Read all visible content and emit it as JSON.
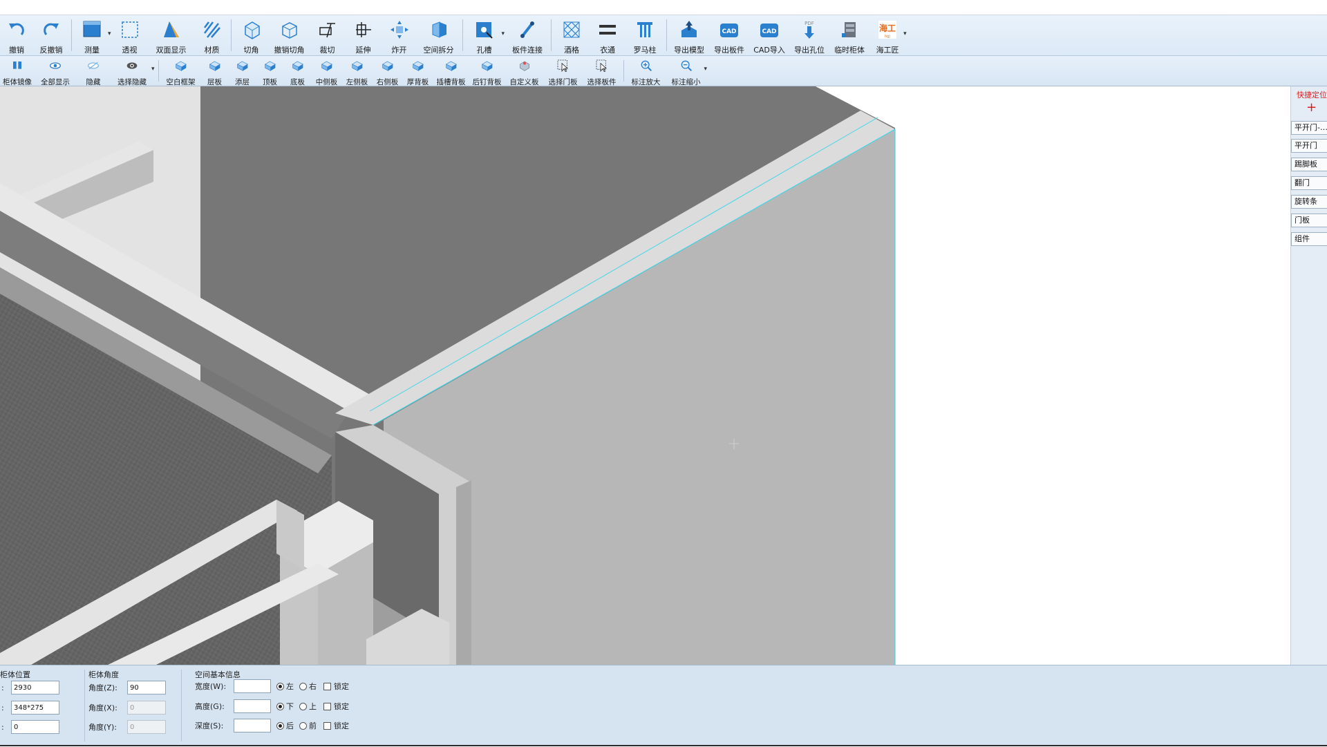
{
  "colors": {
    "accent": "#2a7fcf",
    "selection_edge": "#43d6e8",
    "quick_locate": "#d81e1e",
    "panel_bg": "#d6e4f2"
  },
  "toolbar1": [
    {
      "id": "undo",
      "label": "撤销",
      "icon": "undo-icon"
    },
    {
      "id": "redo",
      "label": "反撤销",
      "icon": "redo-icon"
    },
    {
      "id": "measure",
      "label": "测量",
      "icon": "measure-icon",
      "dropdown": true
    },
    {
      "id": "perspective",
      "label": "透视",
      "icon": "perspective-icon"
    },
    {
      "id": "double-side",
      "label": "双面显示",
      "icon": "double-side-icon"
    },
    {
      "id": "material",
      "label": "材质",
      "icon": "material-icon"
    },
    {
      "id": "cut-corner",
      "label": "切角",
      "icon": "cut-corner-icon"
    },
    {
      "id": "undo-cut-corner",
      "label": "撤销切角",
      "icon": "undo-cut-corner-icon"
    },
    {
      "id": "trim",
      "label": "裁切",
      "icon": "trim-icon"
    },
    {
      "id": "extend",
      "label": "延伸",
      "icon": "extend-icon"
    },
    {
      "id": "explode",
      "label": "炸开",
      "icon": "explode-icon"
    },
    {
      "id": "space-split",
      "label": "空间拆分",
      "icon": "space-split-icon"
    },
    {
      "id": "hole-slot",
      "label": "孔槽",
      "icon": "hole-slot-icon",
      "dropdown": true
    },
    {
      "id": "board-connect",
      "label": "板件连接",
      "icon": "board-connect-icon"
    },
    {
      "id": "grid",
      "label": "酒格",
      "icon": "grid-icon"
    },
    {
      "id": "hanger",
      "label": "衣通",
      "icon": "hanger-icon"
    },
    {
      "id": "roman-column",
      "label": "罗马柱",
      "icon": "roman-column-icon"
    },
    {
      "id": "export-model",
      "label": "导出模型",
      "icon": "export-model-icon"
    },
    {
      "id": "export-board",
      "label": "导出板件",
      "icon": "cad-export-board-icon",
      "badge": "CAD"
    },
    {
      "id": "cad-import",
      "label": "CAD导入",
      "icon": "cad-import-icon",
      "badge": "CAD"
    },
    {
      "id": "export-holes",
      "label": "导出孔位",
      "icon": "pdf-export-icon",
      "badge": "PDF"
    },
    {
      "id": "temp-cabinet",
      "label": "临时柜体",
      "icon": "temp-cabinet-icon"
    },
    {
      "id": "haigongjiang",
      "label": "海工匠",
      "icon": "haigongjiang-logo-icon",
      "badge": "海工匠",
      "dropdown": true
    }
  ],
  "toolbar2": [
    {
      "id": "cabinet-mirror",
      "label": "柜体镜像",
      "icon": "cabinet-mirror-icon"
    },
    {
      "id": "show-all",
      "label": "全部显示",
      "icon": "eye-icon"
    },
    {
      "id": "hide",
      "label": "隐藏",
      "icon": "eye-hide-icon"
    },
    {
      "id": "select-hide",
      "label": "选择隐藏",
      "icon": "eye-select-icon",
      "dropdown": true
    },
    {
      "id": "blank-frame",
      "label": "空白框架",
      "icon": "blank-frame-icon"
    },
    {
      "id": "shelf",
      "label": "层板",
      "icon": "shelf-icon"
    },
    {
      "id": "add-layer",
      "label": "添层",
      "icon": "add-layer-icon"
    },
    {
      "id": "top-board",
      "label": "顶板",
      "icon": "top-board-icon"
    },
    {
      "id": "bottom-board",
      "label": "底板",
      "icon": "bottom-board-icon"
    },
    {
      "id": "middle-side",
      "label": "中侧板",
      "icon": "middle-side-icon"
    },
    {
      "id": "left-side",
      "label": "左侧板",
      "icon": "left-side-icon"
    },
    {
      "id": "right-side",
      "label": "右侧板",
      "icon": "right-side-icon"
    },
    {
      "id": "thick-back",
      "label": "厚背板",
      "icon": "thick-back-icon"
    },
    {
      "id": "slot-back",
      "label": "插槽背板",
      "icon": "slot-back-icon"
    },
    {
      "id": "nail-back",
      "label": "后钉背板",
      "icon": "nail-back-icon"
    },
    {
      "id": "custom-board",
      "label": "自定义板",
      "icon": "custom-board-icon"
    },
    {
      "id": "select-door",
      "label": "选择门板",
      "icon": "select-door-icon"
    },
    {
      "id": "select-part",
      "label": "选择板件",
      "icon": "select-part-icon"
    },
    {
      "id": "zoom-in-label",
      "label": "标注放大",
      "icon": "zoom-in-icon"
    },
    {
      "id": "zoom-out-label",
      "label": "标注缩小",
      "icon": "zoom-out-icon",
      "dropdown": true
    }
  ],
  "right_panel": {
    "title": "快捷定位",
    "buttons": [
      "平开门-…",
      "平开门",
      "踢脚板",
      "翻门",
      "旋转条",
      "门板",
      "组件"
    ]
  },
  "bottom": {
    "position": {
      "title": "柜体位置",
      "rows": [
        {
          "label": ":",
          "value": "2930"
        },
        {
          "label": ":",
          "value": "348*275"
        },
        {
          "label": ":",
          "value": "0"
        }
      ]
    },
    "angle": {
      "title": "柜体角度",
      "rows": [
        {
          "label": "角度(Z):",
          "value": "90"
        },
        {
          "label": "角度(X):",
          "value": "0"
        },
        {
          "label": "角度(Y):",
          "value": "0"
        }
      ]
    },
    "space": {
      "title": "空间基本信息",
      "rows": [
        {
          "label": "宽度(W):",
          "value": "",
          "opt1": "左",
          "opt2": "右",
          "lock": "锁定"
        },
        {
          "label": "高度(G):",
          "value": "",
          "opt1": "下",
          "opt2": "上",
          "lock": "锁定"
        },
        {
          "label": "深度(S):",
          "value": "",
          "opt1": "后",
          "opt2": "前",
          "lock": "锁定"
        }
      ]
    }
  }
}
